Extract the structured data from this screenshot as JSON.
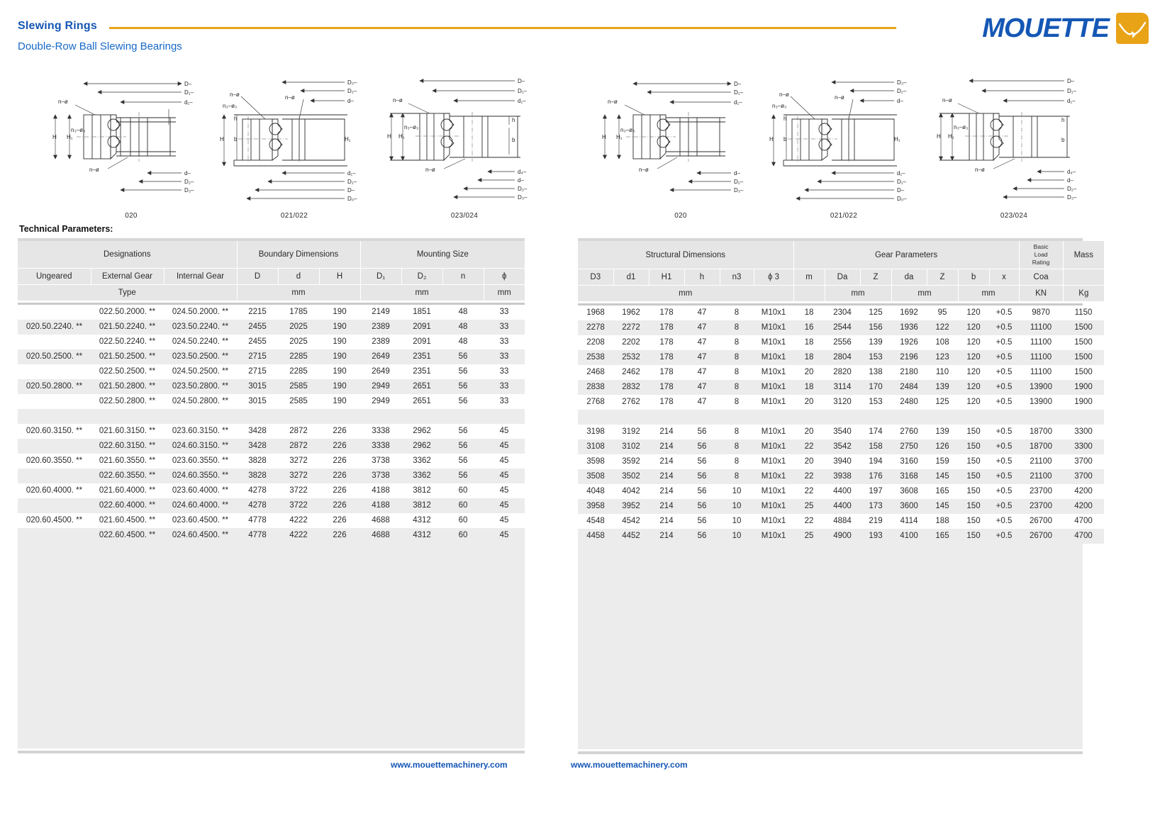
{
  "header": {
    "title": "Slewing Rings",
    "subtitle": "Double-Row Ball Slewing Bearings",
    "logo_text": "MOUETTE",
    "accent_color": "#e8a317",
    "brand_color": "#1557b5"
  },
  "drawings": {
    "captions": [
      "020",
      "021/022",
      "023/024",
      "020",
      "021/022",
      "023/024"
    ],
    "labels": {
      "D": "D",
      "D1": "D₁",
      "D2": "D₂",
      "D3": "D₃",
      "d": "d",
      "d1": "d₁",
      "d4": "d₄",
      "H": "H",
      "H1": "H₁",
      "h": "h",
      "b": "b",
      "n_phi": "n−ø",
      "n3_phi3": "n₃−ø₃"
    }
  },
  "section": {
    "technical_parameters_label": "Technical Parameters:"
  },
  "left_table": {
    "group_headers": [
      "Designations",
      "Boundary Dimensions",
      "Mounting Size"
    ],
    "columns": [
      "Ungeared",
      "External Gear",
      "Internal Gear",
      "D",
      "d",
      "H",
      "D₁",
      "D₂",
      "n",
      "ϕ"
    ],
    "units_row": [
      "Type",
      "",
      "",
      "",
      "mm",
      "",
      "",
      "mm",
      "",
      "mm"
    ],
    "rows": [
      {
        "ungeared": "",
        "external": "022.50.2000. **",
        "internal": "024.50.2000. **",
        "D": "2215",
        "d": "1785",
        "H": "190",
        "D1": "2149",
        "D2": "1851",
        "n": "48",
        "phi": "33"
      },
      {
        "ungeared": "020.50.2240. **",
        "external": "021.50.2240. **",
        "internal": "023.50.2240. **",
        "D": "2455",
        "d": "2025",
        "H": "190",
        "D1": "2389",
        "D2": "2091",
        "n": "48",
        "phi": "33"
      },
      {
        "ungeared": "",
        "external": "022.50.2240. **",
        "internal": "024.50.2240. **",
        "D": "2455",
        "d": "2025",
        "H": "190",
        "D1": "2389",
        "D2": "2091",
        "n": "48",
        "phi": "33"
      },
      {
        "ungeared": "020.50.2500. **",
        "external": "021.50.2500. **",
        "internal": "023.50.2500. **",
        "D": "2715",
        "d": "2285",
        "H": "190",
        "D1": "2649",
        "D2": "2351",
        "n": "56",
        "phi": "33"
      },
      {
        "ungeared": "",
        "external": "022.50.2500. **",
        "internal": "024.50.2500. **",
        "D": "2715",
        "d": "2285",
        "H": "190",
        "D1": "2649",
        "D2": "2351",
        "n": "56",
        "phi": "33"
      },
      {
        "ungeared": "020.50.2800. **",
        "external": "021.50.2800. **",
        "internal": "023.50.2800. **",
        "D": "3015",
        "d": "2585",
        "H": "190",
        "D1": "2949",
        "D2": "2651",
        "n": "56",
        "phi": "33"
      },
      {
        "ungeared": "",
        "external": "022.50.2800. **",
        "internal": "024.50.2800. **",
        "D": "3015",
        "d": "2585",
        "H": "190",
        "D1": "2949",
        "D2": "2651",
        "n": "56",
        "phi": "33"
      },
      {
        "spacer": true
      },
      {
        "ungeared": "020.60.3150. **",
        "external": "021.60.3150. **",
        "internal": "023.60.3150. **",
        "D": "3428",
        "d": "2872",
        "H": "226",
        "D1": "3338",
        "D2": "2962",
        "n": "56",
        "phi": "45"
      },
      {
        "ungeared": "",
        "external": "022.60.3150. **",
        "internal": "024.60.3150. **",
        "D": "3428",
        "d": "2872",
        "H": "226",
        "D1": "3338",
        "D2": "2962",
        "n": "56",
        "phi": "45"
      },
      {
        "ungeared": "020.60.3550. **",
        "external": "021.60.3550. **",
        "internal": "023.60.3550. **",
        "D": "3828",
        "d": "3272",
        "H": "226",
        "D1": "3738",
        "D2": "3362",
        "n": "56",
        "phi": "45"
      },
      {
        "ungeared": "",
        "external": "022.60.3550. **",
        "internal": "024.60.3550. **",
        "D": "3828",
        "d": "3272",
        "H": "226",
        "D1": "3738",
        "D2": "3362",
        "n": "56",
        "phi": "45"
      },
      {
        "ungeared": "020.60.4000. **",
        "external": "021.60.4000. **",
        "internal": "023.60.4000. **",
        "D": "4278",
        "d": "3722",
        "H": "226",
        "D1": "4188",
        "D2": "3812",
        "n": "60",
        "phi": "45"
      },
      {
        "ungeared": "",
        "external": "022.60.4000. **",
        "internal": "024.60.4000. **",
        "D": "4278",
        "d": "3722",
        "H": "226",
        "D1": "4188",
        "D2": "3812",
        "n": "60",
        "phi": "45"
      },
      {
        "ungeared": "020.60.4500. **",
        "external": "021.60.4500. **",
        "internal": "023.60.4500. **",
        "D": "4778",
        "d": "4222",
        "H": "226",
        "D1": "4688",
        "D2": "4312",
        "n": "60",
        "phi": "45"
      },
      {
        "ungeared": "",
        "external": "022.60.4500. **",
        "internal": "024.60.4500. **",
        "D": "4778",
        "d": "4222",
        "H": "226",
        "D1": "4688",
        "D2": "4312",
        "n": "60",
        "phi": "45"
      }
    ]
  },
  "right_table": {
    "group_headers": [
      "Structural Dimensions",
      "Gear Parameters",
      "Basic\nLoad\nRating",
      "Mass"
    ],
    "basic_load_rating_lines": [
      "Basic",
      "Load",
      "Rating"
    ],
    "mass_label": "Mass",
    "columns": [
      "D3",
      "d1",
      "H1",
      "h",
      "n3",
      "ϕ 3",
      "m",
      "Da",
      "Z",
      "da",
      "Z",
      "b",
      "x",
      "Coa",
      ""
    ],
    "units_row": [
      "",
      "",
      "mm",
      "",
      "",
      "",
      "",
      "mm",
      "",
      "mm",
      "",
      "mm",
      "",
      "KN",
      "Kg"
    ],
    "rows": [
      {
        "D3": "1968",
        "d1": "1962",
        "H1": "178",
        "h": "47",
        "n3": "8",
        "phi3": "M10x1",
        "m": "18",
        "Da": "2304",
        "Z1": "125",
        "da": "1692",
        "Z2": "95",
        "b": "120",
        "x": "+0.5",
        "Coa": "9870",
        "mass": "1150"
      },
      {
        "D3": "2278",
        "d1": "2272",
        "H1": "178",
        "h": "47",
        "n3": "8",
        "phi3": "M10x1",
        "m": "16",
        "Da": "2544",
        "Z1": "156",
        "da": "1936",
        "Z2": "122",
        "b": "120",
        "x": "+0.5",
        "Coa": "11100",
        "mass": "1500"
      },
      {
        "D3": "2208",
        "d1": "2202",
        "H1": "178",
        "h": "47",
        "n3": "8",
        "phi3": "M10x1",
        "m": "18",
        "Da": "2556",
        "Z1": "139",
        "da": "1926",
        "Z2": "108",
        "b": "120",
        "x": "+0.5",
        "Coa": "11100",
        "mass": "1500"
      },
      {
        "D3": "2538",
        "d1": "2532",
        "H1": "178",
        "h": "47",
        "n3": "8",
        "phi3": "M10x1",
        "m": "18",
        "Da": "2804",
        "Z1": "153",
        "da": "2196",
        "Z2": "123",
        "b": "120",
        "x": "+0.5",
        "Coa": "11100",
        "mass": "1500"
      },
      {
        "D3": "2468",
        "d1": "2462",
        "H1": "178",
        "h": "47",
        "n3": "8",
        "phi3": "M10x1",
        "m": "20",
        "Da": "2820",
        "Z1": "138",
        "da": "2180",
        "Z2": "110",
        "b": "120",
        "x": "+0.5",
        "Coa": "11100",
        "mass": "1500"
      },
      {
        "D3": "2838",
        "d1": "2832",
        "H1": "178",
        "h": "47",
        "n3": "8",
        "phi3": "M10x1",
        "m": "18",
        "Da": "3114",
        "Z1": "170",
        "da": "2484",
        "Z2": "139",
        "b": "120",
        "x": "+0.5",
        "Coa": "13900",
        "mass": "1900"
      },
      {
        "D3": "2768",
        "d1": "2762",
        "H1": "178",
        "h": "47",
        "n3": "8",
        "phi3": "M10x1",
        "m": "20",
        "Da": "3120",
        "Z1": "153",
        "da": "2480",
        "Z2": "125",
        "b": "120",
        "x": "+0.5",
        "Coa": "13900",
        "mass": "1900"
      },
      {
        "spacer": true
      },
      {
        "D3": "3198",
        "d1": "3192",
        "H1": "214",
        "h": "56",
        "n3": "8",
        "phi3": "M10x1",
        "m": "20",
        "Da": "3540",
        "Z1": "174",
        "da": "2760",
        "Z2": "139",
        "b": "150",
        "x": "+0.5",
        "Coa": "18700",
        "mass": "3300"
      },
      {
        "D3": "3108",
        "d1": "3102",
        "H1": "214",
        "h": "56",
        "n3": "8",
        "phi3": "M10x1",
        "m": "22",
        "Da": "3542",
        "Z1": "158",
        "da": "2750",
        "Z2": "126",
        "b": "150",
        "x": "+0.5",
        "Coa": "18700",
        "mass": "3300"
      },
      {
        "D3": "3598",
        "d1": "3592",
        "H1": "214",
        "h": "56",
        "n3": "8",
        "phi3": "M10x1",
        "m": "20",
        "Da": "3940",
        "Z1": "194",
        "da": "3160",
        "Z2": "159",
        "b": "150",
        "x": "+0.5",
        "Coa": "21100",
        "mass": "3700"
      },
      {
        "D3": "3508",
        "d1": "3502",
        "H1": "214",
        "h": "56",
        "n3": "8",
        "phi3": "M10x1",
        "m": "22",
        "Da": "3938",
        "Z1": "176",
        "da": "3168",
        "Z2": "145",
        "b": "150",
        "x": "+0.5",
        "Coa": "21100",
        "mass": "3700"
      },
      {
        "D3": "4048",
        "d1": "4042",
        "H1": "214",
        "h": "56",
        "n3": "10",
        "phi3": "M10x1",
        "m": "22",
        "Da": "4400",
        "Z1": "197",
        "da": "3608",
        "Z2": "165",
        "b": "150",
        "x": "+0.5",
        "Coa": "23700",
        "mass": "4200"
      },
      {
        "D3": "3958",
        "d1": "3952",
        "H1": "214",
        "h": "56",
        "n3": "10",
        "phi3": "M10x1",
        "m": "25",
        "Da": "4400",
        "Z1": "173",
        "da": "3600",
        "Z2": "145",
        "b": "150",
        "x": "+0.5",
        "Coa": "23700",
        "mass": "4200"
      },
      {
        "D3": "4548",
        "d1": "4542",
        "H1": "214",
        "h": "56",
        "n3": "10",
        "phi3": "M10x1",
        "m": "22",
        "Da": "4884",
        "Z1": "219",
        "da": "4114",
        "Z2": "188",
        "b": "150",
        "x": "+0.5",
        "Coa": "26700",
        "mass": "4700"
      },
      {
        "D3": "4458",
        "d1": "4452",
        "H1": "214",
        "h": "56",
        "n3": "10",
        "phi3": "M10x1",
        "m": "25",
        "Da": "4900",
        "Z1": "193",
        "da": "4100",
        "Z2": "165",
        "b": "150",
        "x": "+0.5",
        "Coa": "26700",
        "mass": "4700"
      }
    ]
  },
  "footer": {
    "link_left": "www.mouettemachinery.com",
    "link_right": "www.mouettemachinery.com"
  }
}
